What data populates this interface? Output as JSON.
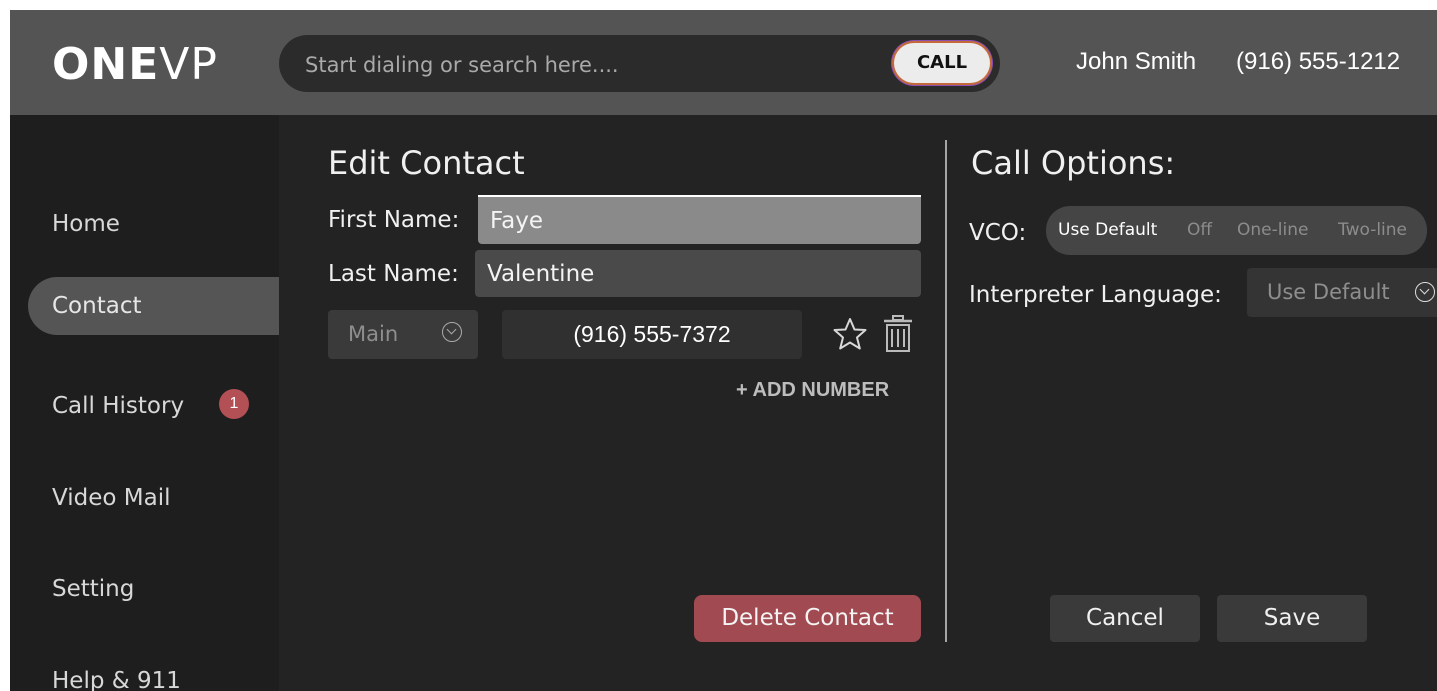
{
  "header": {
    "logo_bold": "ONE",
    "logo_light": "VP",
    "search_placeholder": "Start dialing or search here....",
    "call_label": "CALL",
    "user_name": "John Smith",
    "user_phone": "(916) 555-1212"
  },
  "sidebar": {
    "items": [
      {
        "label": "Home"
      },
      {
        "label": "Contact",
        "active": true
      },
      {
        "label": "Call History",
        "badge": "1"
      },
      {
        "label": "Video Mail"
      },
      {
        "label": "Setting"
      },
      {
        "label": "Help & 911"
      }
    ]
  },
  "edit_contact": {
    "title": "Edit Contact",
    "first_name_label": "First Name:",
    "first_name_value": "Faye",
    "last_name_label": "Last Name:",
    "last_name_value": "Valentine",
    "phone_type": "Main",
    "phone_number": "(916) 555-7372",
    "add_number_label": "+ ADD NUMBER",
    "delete_label": "Delete Contact",
    "star_icon": "star-icon",
    "trash_icon": "trash-icon"
  },
  "call_options": {
    "title": "Call Options:",
    "vco_label": "VCO:",
    "vco_options": [
      "Use Default",
      "Off",
      "One-line",
      "Two-line"
    ],
    "vco_selected": "Use Default",
    "interpreter_label": "Interpreter Language:",
    "interpreter_value": "Use Default"
  },
  "actions": {
    "cancel_label": "Cancel",
    "save_label": "Save"
  },
  "colors": {
    "header_bg": "#545454",
    "app_bg": "#232323",
    "delete_btn": "#a24a52",
    "badge": "#b35056"
  }
}
